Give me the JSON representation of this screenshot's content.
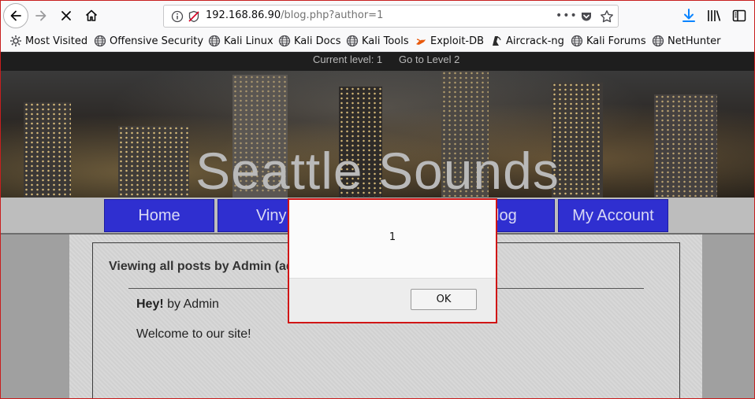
{
  "browser": {
    "url_host": "192.168.86.90",
    "url_path": "/blog.php?author=1",
    "url_more": "•••"
  },
  "bookmarks": [
    {
      "label": "Most Visited",
      "icon": "gear-icon"
    },
    {
      "label": "Offensive Security",
      "icon": "globe-icon"
    },
    {
      "label": "Kali Linux",
      "icon": "globe-icon"
    },
    {
      "label": "Kali Docs",
      "icon": "globe-icon"
    },
    {
      "label": "Kali Tools",
      "icon": "globe-icon"
    },
    {
      "label": "Exploit-DB",
      "icon": "exploitdb-icon"
    },
    {
      "label": "Aircrack-ng",
      "icon": "aircrack-icon"
    },
    {
      "label": "Kali Forums",
      "icon": "globe-icon"
    },
    {
      "label": "NetHunter",
      "icon": "globe-icon"
    }
  ],
  "level_bar": {
    "current": "Current level:  1",
    "next": "Go to Level 2"
  },
  "site": {
    "title": "Seattle Sounds",
    "nav": [
      "Home",
      "Viny",
      "log",
      "My Account"
    ]
  },
  "content": {
    "heading": "Viewing all posts by Admin (ad",
    "post_title_bold": "Hey!",
    "post_title_rest": " by Admin",
    "post_body": "Welcome to our site!"
  },
  "dialog": {
    "message": "1",
    "ok_label": "OK"
  },
  "colors": {
    "nav_button": "#2f2fd0",
    "dialog_border": "#d01515",
    "accent_download": "#0a84ff"
  }
}
